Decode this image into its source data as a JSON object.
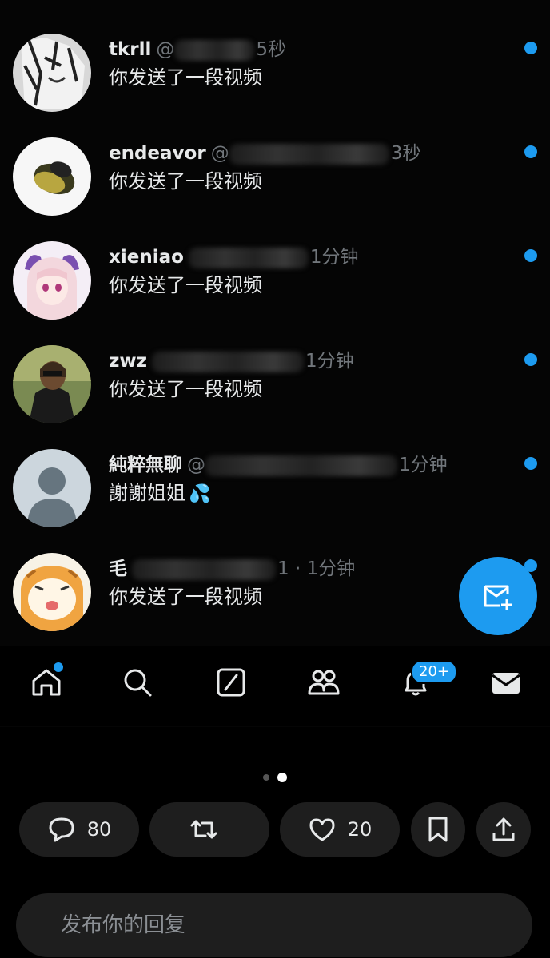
{
  "conversations": [
    {
      "name": "tkrll",
      "handle": "@",
      "time": "5秒",
      "message": "你发送了一段视频",
      "unread": true,
      "avatar": "manga-portrait"
    },
    {
      "name": "endeavor",
      "handle": "@",
      "time": "3秒",
      "message": "你发送了一段视频",
      "unread": true,
      "avatar": "avocado"
    },
    {
      "name": "xieniao",
      "handle": "",
      "time": "1分钟",
      "message": "你发送了一段视频",
      "unread": true,
      "avatar": "anime-girl"
    },
    {
      "name": "zwz",
      "handle": "",
      "time": "1分钟",
      "message": "你发送了一段视频",
      "unread": true,
      "avatar": "photo-person"
    },
    {
      "name": "純粹無聊",
      "handle": "@",
      "time": "1分钟",
      "message": "謝謝姐姐",
      "message_emoji": "💦",
      "unread": true,
      "avatar": "default-silhouette"
    },
    {
      "name": "毛",
      "handle": "",
      "time": "1 · 1分钟",
      "message": "你发送了一段视频",
      "unread": true,
      "avatar": "cartoon-cat"
    }
  ],
  "fab": {
    "icon": "new-message-icon"
  },
  "tabbar": {
    "tabs": [
      {
        "id": "home",
        "icon": "home-icon",
        "has_dot": true
      },
      {
        "id": "search",
        "icon": "search-icon"
      },
      {
        "id": "grok",
        "icon": "grok-icon"
      },
      {
        "id": "communities",
        "icon": "people-icon"
      },
      {
        "id": "notifications",
        "icon": "bell-icon",
        "badge": "20+"
      },
      {
        "id": "messages",
        "icon": "mail-icon",
        "active": true
      }
    ]
  },
  "carousel": {
    "count": 2,
    "active_index": 1
  },
  "actions": {
    "comments": {
      "icon": "comment-icon",
      "count": "80"
    },
    "retweets": {
      "icon": "retweet-icon",
      "count": ""
    },
    "likes": {
      "icon": "heart-icon",
      "count": "20"
    },
    "bookmark": {
      "icon": "bookmark-icon"
    },
    "share": {
      "icon": "share-icon"
    }
  },
  "reply": {
    "placeholder": "发布你的回复"
  },
  "colors": {
    "accent": "#1d9bf0",
    "background": "#000000",
    "secondary_text": "#71767b",
    "pill_bg": "#1e1e1e"
  }
}
